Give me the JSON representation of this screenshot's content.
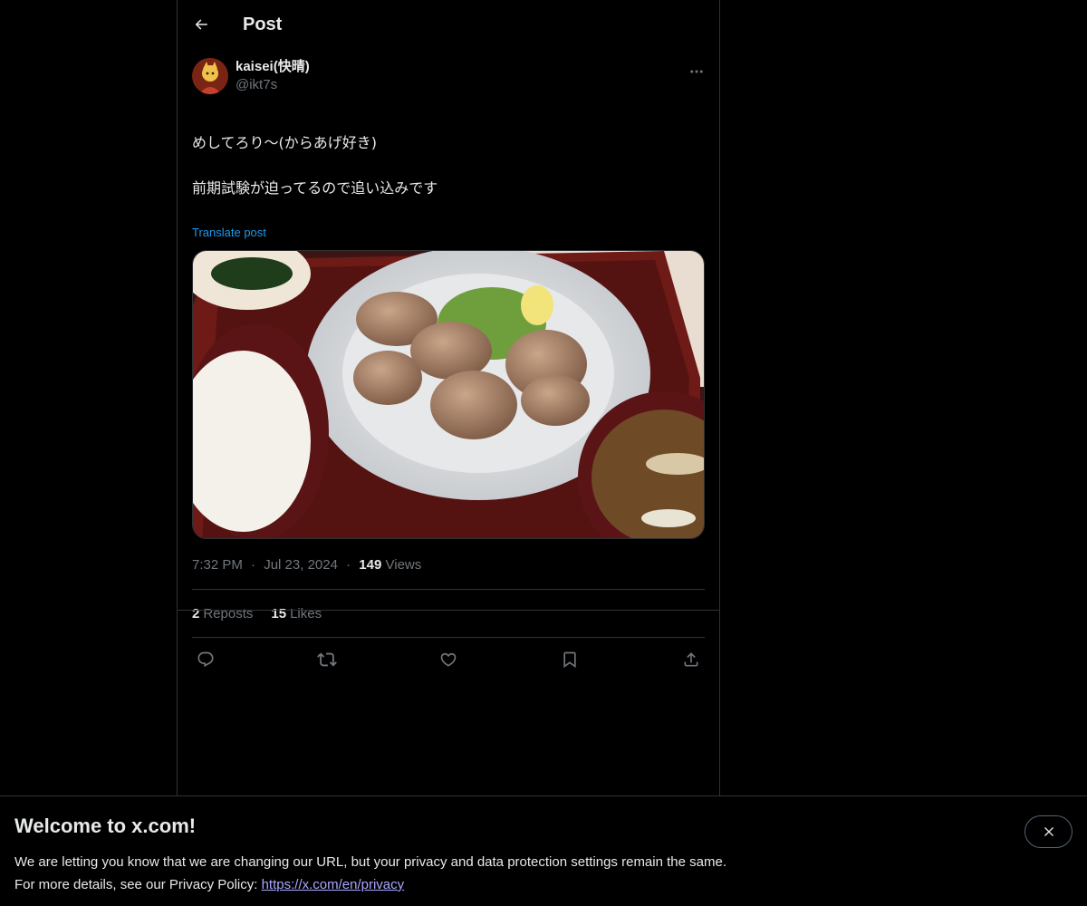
{
  "header": {
    "title": "Post",
    "back_icon": "arrow-left-icon"
  },
  "post": {
    "author": {
      "display_name": "kaisei(快晴)",
      "handle": "@ikt7s"
    },
    "text_line1": "めしてろり〜(からあげ好き)",
    "text_line2": "前期試験が迫ってるので追い込みです",
    "translate_label": "Translate post",
    "time": "7:32 PM",
    "date": "Jul 23, 2024",
    "views_count": "149",
    "views_label": "Views",
    "reposts_count": "2",
    "reposts_label": "Reposts",
    "likes_count": "15",
    "likes_label": "Likes",
    "separator": "·"
  },
  "actions": [
    "reply-icon",
    "repost-icon",
    "like-icon",
    "bookmark-icon",
    "share-icon"
  ],
  "banner": {
    "title": "Welcome to x.com!",
    "line1": "We are letting you know that we are changing our URL, but your privacy and data protection settings remain the same.",
    "line2_prefix": "For more details, see our Privacy Policy: ",
    "link": "https://x.com/en/privacy"
  },
  "colors": {
    "accent": "#1d9bf0",
    "muted": "#71767b",
    "text": "#e7e9ea",
    "border": "#2f3336",
    "link_banner": "#a9a6ff"
  }
}
